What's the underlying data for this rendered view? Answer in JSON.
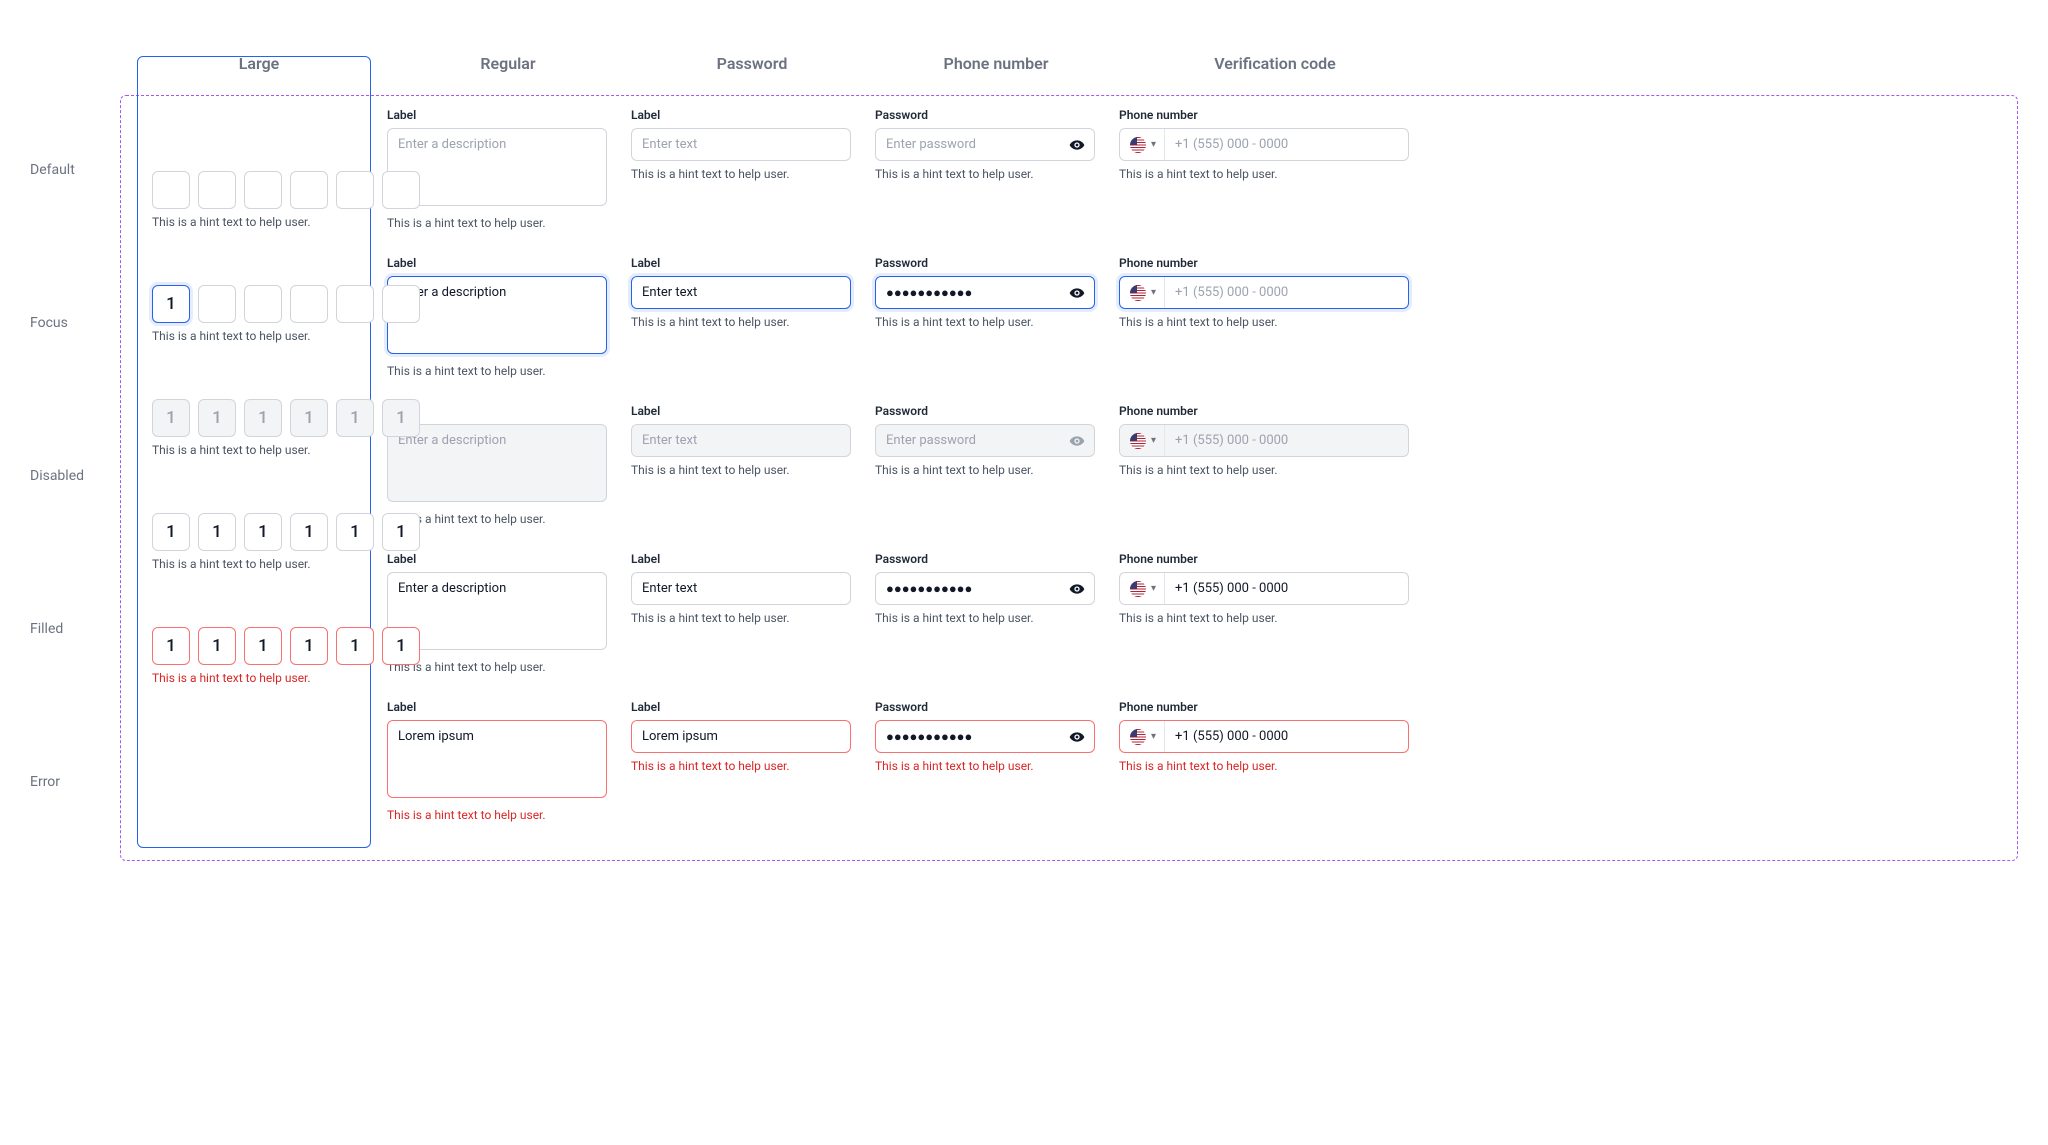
{
  "columns": [
    "Large",
    "Regular",
    "Password",
    "Phone number",
    "Verification code"
  ],
  "rows": [
    "Default",
    "Focus",
    "Disabled",
    "Filled",
    "Error"
  ],
  "labels": {
    "label": "Label",
    "password": "Password",
    "phone": "Phone number"
  },
  "placeholders": {
    "large": "Enter a description",
    "regular": "Enter text",
    "password": "Enter password",
    "phone": "+1 (555) 000 - 0000"
  },
  "values": {
    "large_focus": "Enter a description",
    "large_filled": "Enter a description",
    "large_error": "Lorem ipsum",
    "regular_focus": "Enter text",
    "regular_filled": "Enter text",
    "regular_error": "Lorem ipsum",
    "password_masked": "●●●●●●●●●●●",
    "phone_filled": "+1 (555) 000 - 0000",
    "otp_digit": "1"
  },
  "hint": "This is a hint text to help user."
}
